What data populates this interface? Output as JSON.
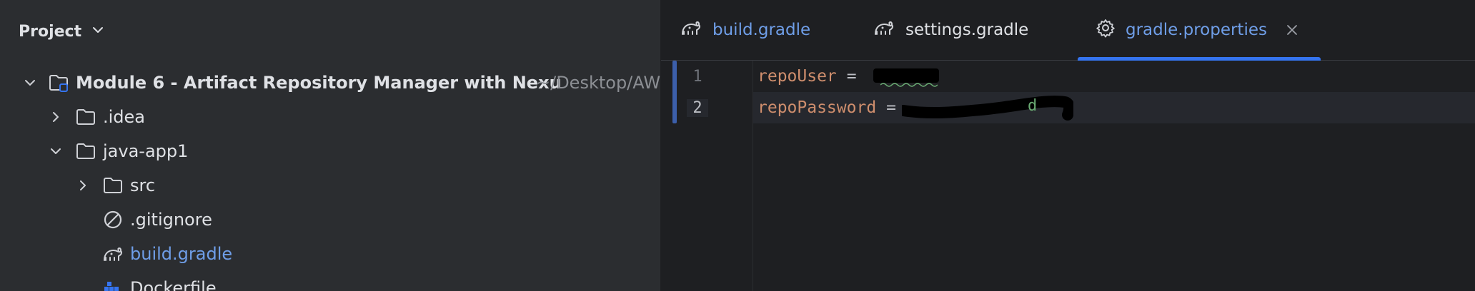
{
  "project_panel": {
    "title": "Project",
    "tree": [
      {
        "label": "Module 6 - Artifact Repository Manager with Nexu",
        "path_hint": "~/Desktop/AW",
        "icon": "module-folder-icon",
        "expanded": true
      },
      {
        "label": ".idea",
        "icon": "folder-icon",
        "expanded": false
      },
      {
        "label": "java-app1",
        "icon": "folder-icon",
        "expanded": true
      },
      {
        "label": "src",
        "icon": "folder-icon",
        "expanded": false
      },
      {
        "label": ".gitignore",
        "icon": "ignore-file-icon"
      },
      {
        "label": "build.gradle",
        "icon": "gradle-icon"
      },
      {
        "label": "Dockerfile",
        "icon": "docker-icon"
      }
    ]
  },
  "editor": {
    "tabs": [
      {
        "label": "build.gradle",
        "icon": "gradle-icon",
        "active": false
      },
      {
        "label": "settings.gradle",
        "icon": "gradle-icon",
        "active": false
      },
      {
        "label": "gradle.properties",
        "icon": "gear-icon",
        "active": true,
        "closable": true
      }
    ],
    "lines": [
      {
        "number": "1",
        "key": "repoUser",
        "equals": "=",
        "value_redacted": true
      },
      {
        "number": "2",
        "key": "repoPassword",
        "equals": "=",
        "value_redacted": true
      }
    ]
  },
  "colors": {
    "panel_bg": "#2b2d30",
    "editor_bg": "#1e1f22",
    "accent": "#3574f0",
    "link": "#6f9ee8",
    "keyword": "#cf8e6d",
    "string": "#6aab73"
  }
}
